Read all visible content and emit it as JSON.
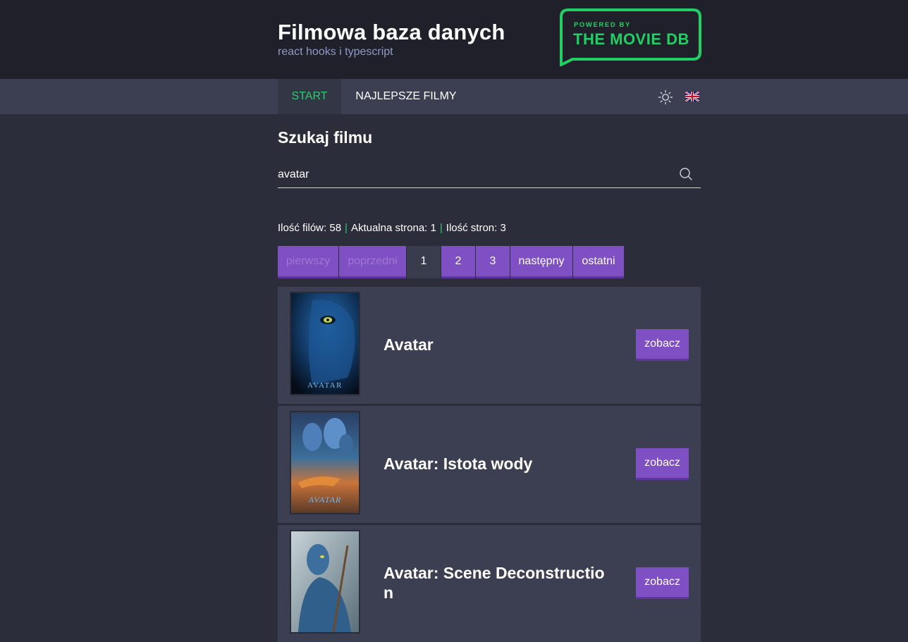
{
  "header": {
    "title": "Filmowa baza danych",
    "subtitle": "react hooks i typescript",
    "logo": {
      "line1": "POWERED BY",
      "line2": "THE MOVIE DB",
      "color": "#20d064"
    }
  },
  "nav": {
    "items": [
      {
        "label": "START",
        "active": true
      },
      {
        "label": "NAJLEPSZE FILMY",
        "active": false
      }
    ],
    "theme_icon": "sun-icon",
    "language_icon": "uk-flag-icon"
  },
  "search": {
    "heading": "Szukaj filmu",
    "value": "avatar",
    "icon": "search-icon"
  },
  "stats": {
    "count_label": "Ilość filów: 58",
    "page_label": "Aktualna strona: 1",
    "pages_label": "Ilość stron: 3",
    "separator": "|"
  },
  "pagination": {
    "first": "pierwszy",
    "prev": "poprzedni",
    "pages": [
      "1",
      "2",
      "3"
    ],
    "next": "następny",
    "last": "ostatni"
  },
  "movies": [
    {
      "title": "Avatar",
      "poster_text": "AVATAR",
      "button": "zobacz"
    },
    {
      "title": "Avatar: Istota wody",
      "poster_text": "AVATAR",
      "button": "zobacz"
    },
    {
      "title": "Avatar: Scene Deconstruction",
      "button": "zobacz"
    }
  ],
  "colors": {
    "accent_green": "#2ecc71",
    "button_purple": "#7f4fc4",
    "header_bg": "#1f2029",
    "nav_bg": "#3c3f51",
    "page_bg": "#2b2d3a"
  }
}
